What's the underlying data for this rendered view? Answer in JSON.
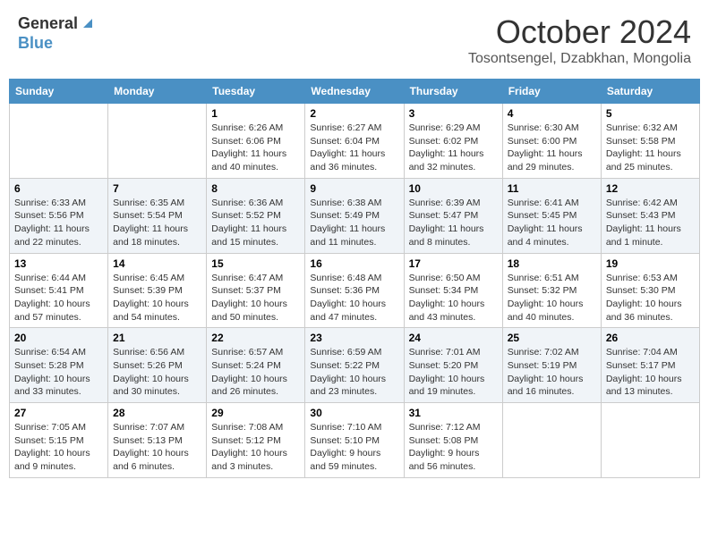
{
  "header": {
    "logo_general": "General",
    "logo_blue": "Blue",
    "month_title": "October 2024",
    "location": "Tosontsengel, Dzabkhan, Mongolia"
  },
  "weekdays": [
    "Sunday",
    "Monday",
    "Tuesday",
    "Wednesday",
    "Thursday",
    "Friday",
    "Saturday"
  ],
  "weeks": [
    [
      {
        "day": "",
        "info": ""
      },
      {
        "day": "",
        "info": ""
      },
      {
        "day": "1",
        "info": "Sunrise: 6:26 AM\nSunset: 6:06 PM\nDaylight: 11 hours and 40 minutes."
      },
      {
        "day": "2",
        "info": "Sunrise: 6:27 AM\nSunset: 6:04 PM\nDaylight: 11 hours and 36 minutes."
      },
      {
        "day": "3",
        "info": "Sunrise: 6:29 AM\nSunset: 6:02 PM\nDaylight: 11 hours and 32 minutes."
      },
      {
        "day": "4",
        "info": "Sunrise: 6:30 AM\nSunset: 6:00 PM\nDaylight: 11 hours and 29 minutes."
      },
      {
        "day": "5",
        "info": "Sunrise: 6:32 AM\nSunset: 5:58 PM\nDaylight: 11 hours and 25 minutes."
      }
    ],
    [
      {
        "day": "6",
        "info": "Sunrise: 6:33 AM\nSunset: 5:56 PM\nDaylight: 11 hours and 22 minutes."
      },
      {
        "day": "7",
        "info": "Sunrise: 6:35 AM\nSunset: 5:54 PM\nDaylight: 11 hours and 18 minutes."
      },
      {
        "day": "8",
        "info": "Sunrise: 6:36 AM\nSunset: 5:52 PM\nDaylight: 11 hours and 15 minutes."
      },
      {
        "day": "9",
        "info": "Sunrise: 6:38 AM\nSunset: 5:49 PM\nDaylight: 11 hours and 11 minutes."
      },
      {
        "day": "10",
        "info": "Sunrise: 6:39 AM\nSunset: 5:47 PM\nDaylight: 11 hours and 8 minutes."
      },
      {
        "day": "11",
        "info": "Sunrise: 6:41 AM\nSunset: 5:45 PM\nDaylight: 11 hours and 4 minutes."
      },
      {
        "day": "12",
        "info": "Sunrise: 6:42 AM\nSunset: 5:43 PM\nDaylight: 11 hours and 1 minute."
      }
    ],
    [
      {
        "day": "13",
        "info": "Sunrise: 6:44 AM\nSunset: 5:41 PM\nDaylight: 10 hours and 57 minutes."
      },
      {
        "day": "14",
        "info": "Sunrise: 6:45 AM\nSunset: 5:39 PM\nDaylight: 10 hours and 54 minutes."
      },
      {
        "day": "15",
        "info": "Sunrise: 6:47 AM\nSunset: 5:37 PM\nDaylight: 10 hours and 50 minutes."
      },
      {
        "day": "16",
        "info": "Sunrise: 6:48 AM\nSunset: 5:36 PM\nDaylight: 10 hours and 47 minutes."
      },
      {
        "day": "17",
        "info": "Sunrise: 6:50 AM\nSunset: 5:34 PM\nDaylight: 10 hours and 43 minutes."
      },
      {
        "day": "18",
        "info": "Sunrise: 6:51 AM\nSunset: 5:32 PM\nDaylight: 10 hours and 40 minutes."
      },
      {
        "day": "19",
        "info": "Sunrise: 6:53 AM\nSunset: 5:30 PM\nDaylight: 10 hours and 36 minutes."
      }
    ],
    [
      {
        "day": "20",
        "info": "Sunrise: 6:54 AM\nSunset: 5:28 PM\nDaylight: 10 hours and 33 minutes."
      },
      {
        "day": "21",
        "info": "Sunrise: 6:56 AM\nSunset: 5:26 PM\nDaylight: 10 hours and 30 minutes."
      },
      {
        "day": "22",
        "info": "Sunrise: 6:57 AM\nSunset: 5:24 PM\nDaylight: 10 hours and 26 minutes."
      },
      {
        "day": "23",
        "info": "Sunrise: 6:59 AM\nSunset: 5:22 PM\nDaylight: 10 hours and 23 minutes."
      },
      {
        "day": "24",
        "info": "Sunrise: 7:01 AM\nSunset: 5:20 PM\nDaylight: 10 hours and 19 minutes."
      },
      {
        "day": "25",
        "info": "Sunrise: 7:02 AM\nSunset: 5:19 PM\nDaylight: 10 hours and 16 minutes."
      },
      {
        "day": "26",
        "info": "Sunrise: 7:04 AM\nSunset: 5:17 PM\nDaylight: 10 hours and 13 minutes."
      }
    ],
    [
      {
        "day": "27",
        "info": "Sunrise: 7:05 AM\nSunset: 5:15 PM\nDaylight: 10 hours and 9 minutes."
      },
      {
        "day": "28",
        "info": "Sunrise: 7:07 AM\nSunset: 5:13 PM\nDaylight: 10 hours and 6 minutes."
      },
      {
        "day": "29",
        "info": "Sunrise: 7:08 AM\nSunset: 5:12 PM\nDaylight: 10 hours and 3 minutes."
      },
      {
        "day": "30",
        "info": "Sunrise: 7:10 AM\nSunset: 5:10 PM\nDaylight: 9 hours and 59 minutes."
      },
      {
        "day": "31",
        "info": "Sunrise: 7:12 AM\nSunset: 5:08 PM\nDaylight: 9 hours and 56 minutes."
      },
      {
        "day": "",
        "info": ""
      },
      {
        "day": "",
        "info": ""
      }
    ]
  ]
}
